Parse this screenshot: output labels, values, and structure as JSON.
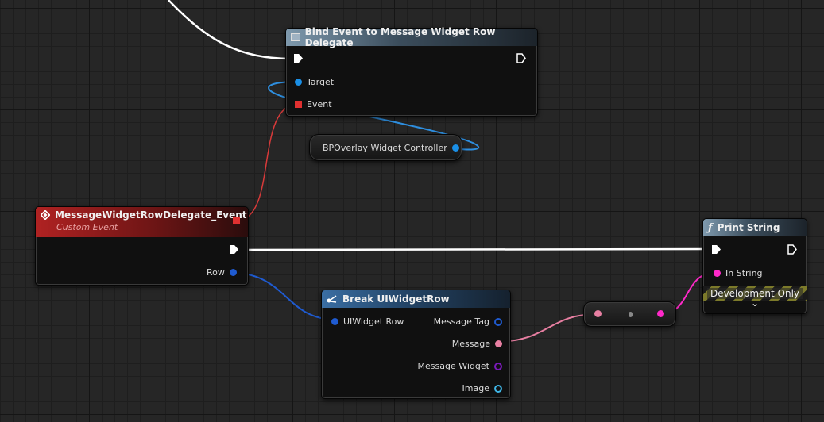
{
  "nodes": {
    "bind_event": {
      "title": "Bind Event to Message Widget Row Delegate",
      "pins": {
        "target": "Target",
        "event": "Event"
      }
    },
    "widget_controller": {
      "label": "BPOverlay Widget Controller"
    },
    "custom_event": {
      "title": "MessageWidgetRowDelegate_Event",
      "subtitle": "Custom Event",
      "pins": {
        "row": "Row"
      }
    },
    "break_row": {
      "title": "Break UIWidgetRow",
      "pins": {
        "input": "UIWidget Row",
        "message_tag": "Message Tag",
        "message": "Message",
        "message_widget": "Message Widget",
        "image": "Image"
      }
    },
    "print_string": {
      "title": "Print String",
      "pins": {
        "in_string": "In String"
      },
      "dev_label": "Development Only",
      "expand_glyph": "⌄"
    }
  },
  "colors": {
    "exec": "#ffffff",
    "object": "#1a8fe6",
    "delegate": "#e03030",
    "struct": "#1f5bd1",
    "text": "#e87fa2",
    "string": "#ff29c9",
    "texture": "#3fb6e6",
    "widget": "#7a1ab8"
  }
}
